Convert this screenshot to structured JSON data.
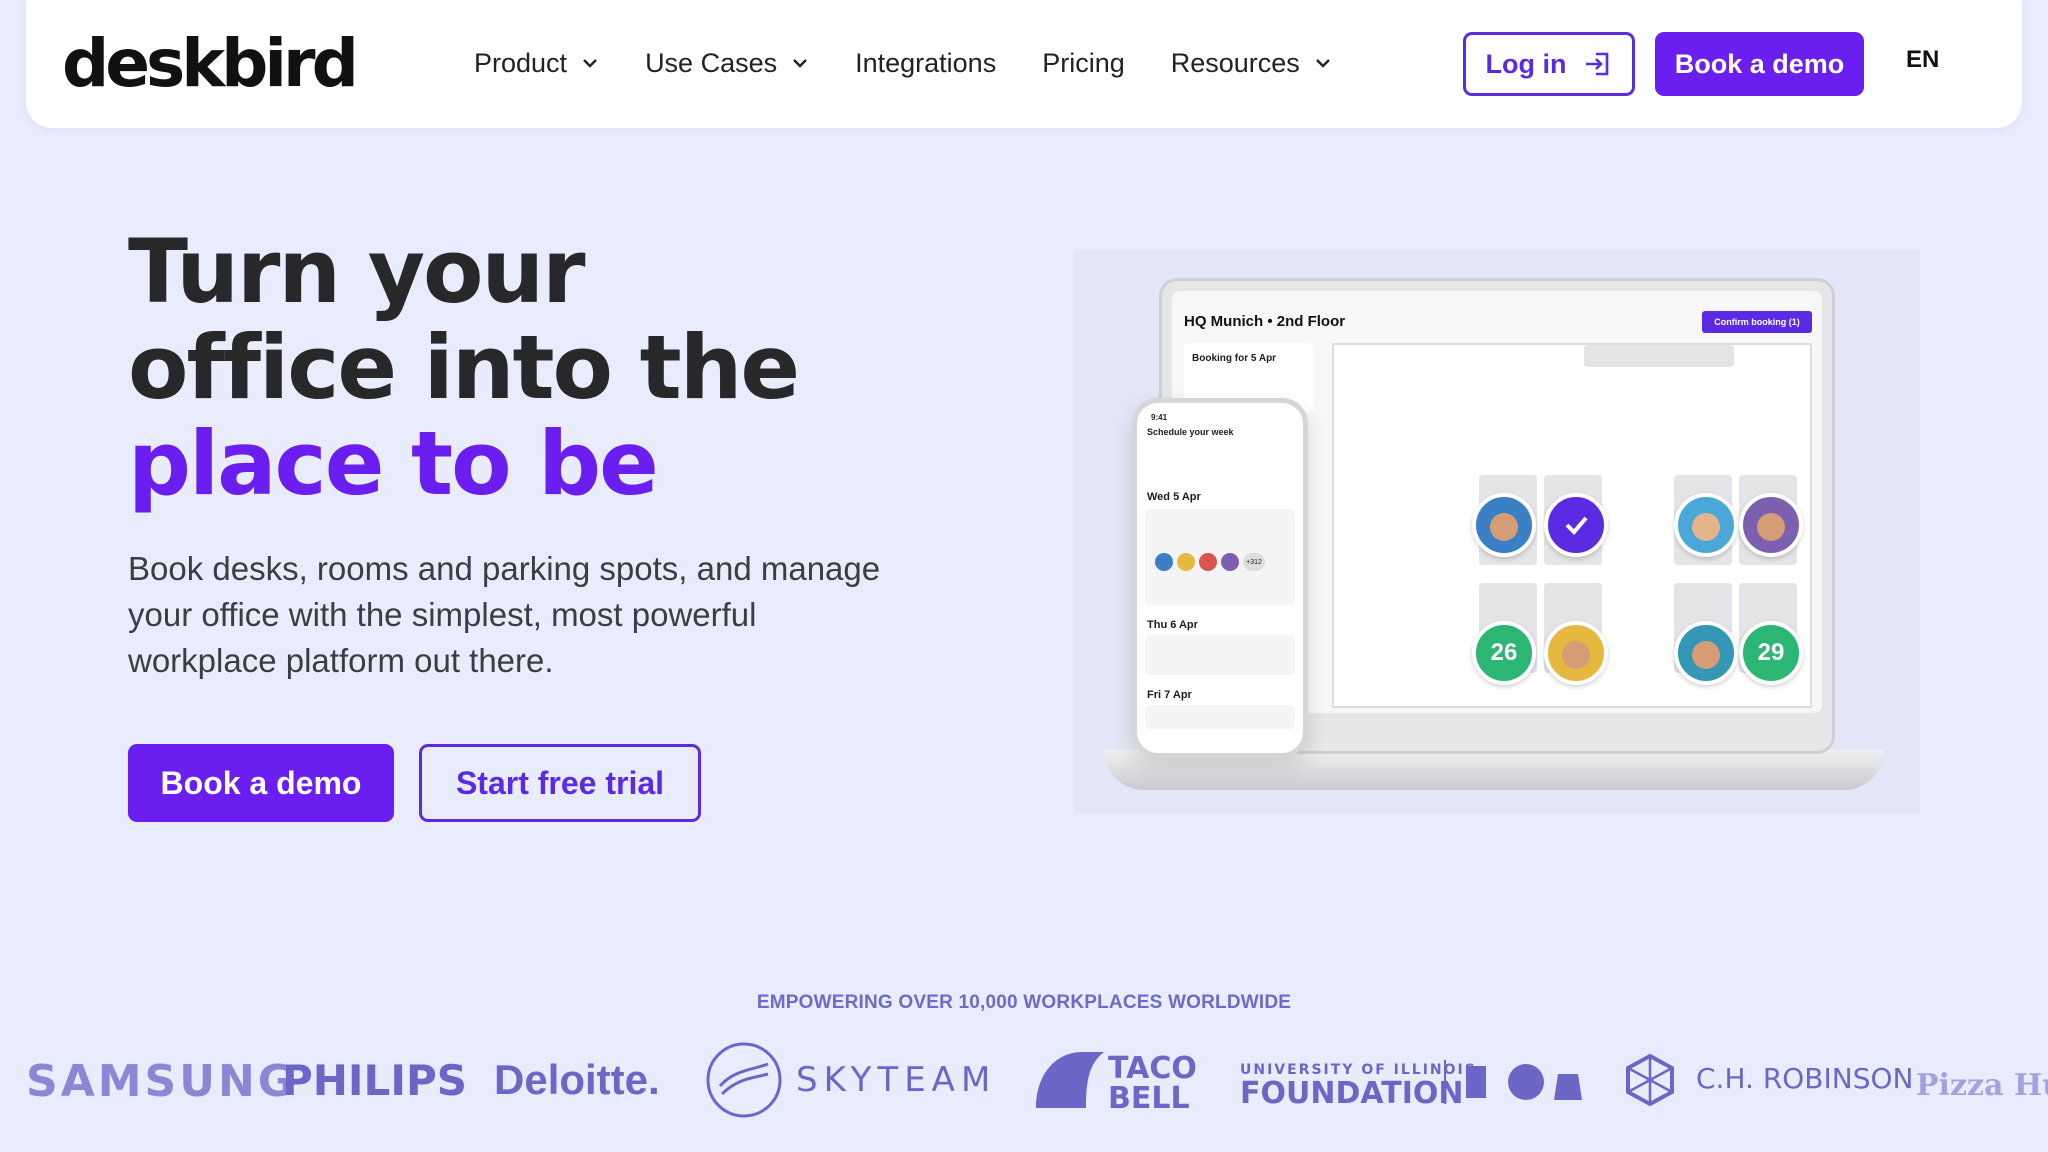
{
  "nav": {
    "logo": "deskbird",
    "items": [
      {
        "label": "Product",
        "dropdown": true
      },
      {
        "label": "Use Cases",
        "dropdown": true
      },
      {
        "label": "Integrations",
        "dropdown": false
      },
      {
        "label": "Pricing",
        "dropdown": false
      },
      {
        "label": "Resources",
        "dropdown": true
      }
    ],
    "login_label": "Log in",
    "demo_label": "Book a demo",
    "language": "EN"
  },
  "hero": {
    "headline_line1": "Turn your",
    "headline_line2": "office into the",
    "headline_accent": "place to be",
    "subtext": "Book desks, rooms and parking spots, and manage your office with the simplest, most powerful workplace platform out there.",
    "cta_primary": "Book a demo",
    "cta_secondary": "Start free trial"
  },
  "mockup": {
    "floor_title": "HQ Munich • 2nd Floor",
    "confirm_button": "Confirm booking (1)",
    "booking_panel_title": "Booking for 5 Apr",
    "seat_numbers": [
      "26",
      "29"
    ],
    "phone": {
      "time": "9:41",
      "title": "Schedule your week",
      "days": [
        "Wed 5 Apr",
        "Thu 6 Apr",
        "Fri 7 Apr"
      ],
      "avatar_overflow": "+312"
    }
  },
  "logos": {
    "tagline": "EMPOWERING OVER 10,000 WORKPLACES WORLDWIDE",
    "brands": [
      "SAMSUNG",
      "PHILIPS",
      "Deloitte.",
      "SKYTEAM",
      "TACO BELL",
      "UNIVERSITY OF ILLINOIS",
      "FOUNDATION",
      "C.H. ROBINSON",
      "Pizza Hut"
    ]
  },
  "colors": {
    "accent": "#6a1ef0",
    "background": "#e8ecfd",
    "logo_tint": "#6b67c7"
  }
}
